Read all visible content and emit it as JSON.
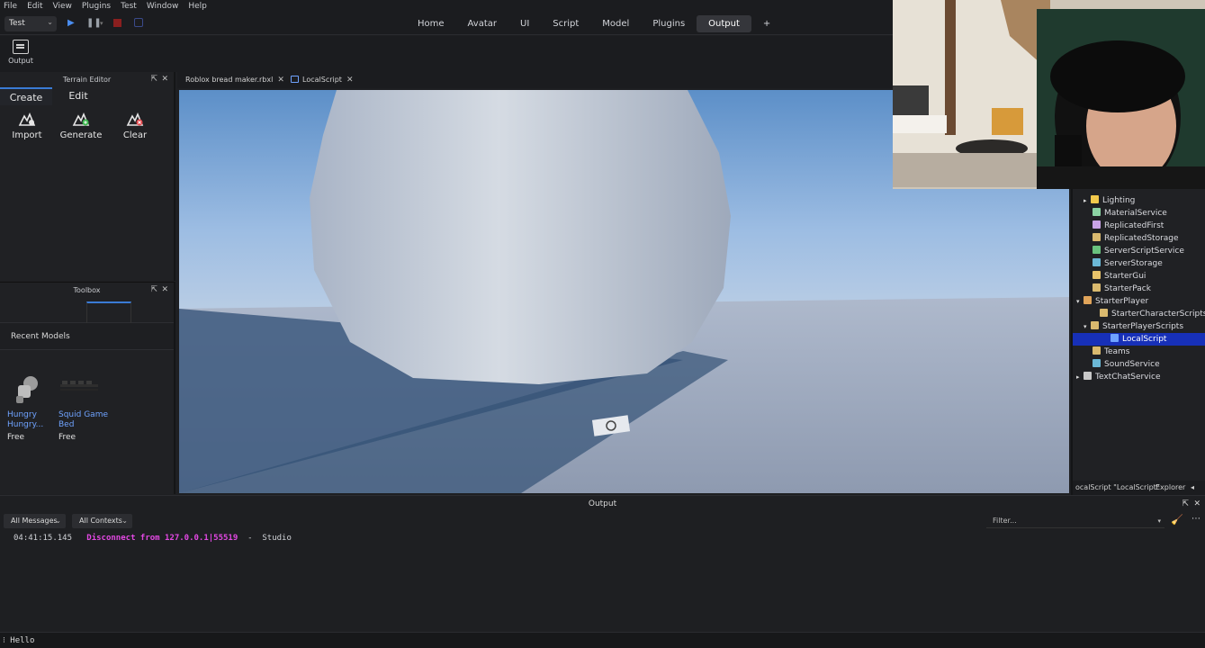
{
  "menubar": [
    "File",
    "Edit",
    "View",
    "Plugins",
    "Test",
    "Window",
    "Help"
  ],
  "toolbar": {
    "mode": "Test"
  },
  "ribbon_tabs": [
    "Home",
    "Avatar",
    "UI",
    "Script",
    "Model",
    "Plugins",
    "Output",
    "+"
  ],
  "ribbon_active": "Output",
  "ribbon": {
    "output_label": "Output"
  },
  "terrain_editor": {
    "title": "Terrain Editor",
    "tabs": [
      "Create",
      "Edit"
    ],
    "tools": [
      "Import",
      "Generate",
      "Clear"
    ]
  },
  "toolbox": {
    "title": "Toolbox",
    "section": "Recent Models",
    "models": [
      {
        "name": "Hungry Hungry...",
        "price": "Free"
      },
      {
        "name": "Squid Game Bed",
        "price": "Free"
      }
    ]
  },
  "doc_tabs": [
    "Roblox bread maker.rbxl",
    "LocalScript"
  ],
  "explorer": {
    "items": [
      {
        "label": "Lighting",
        "icon_color": "#f2c94c",
        "arrow": "▸"
      },
      {
        "label": "MaterialService",
        "icon_color": "#8bd3a3",
        "arrow": ""
      },
      {
        "label": "ReplicatedFirst",
        "icon_color": "#c9a3e6",
        "arrow": ""
      },
      {
        "label": "ReplicatedStorage",
        "icon_color": "#d9b96e",
        "arrow": ""
      },
      {
        "label": "ServerScriptService",
        "icon_color": "#69c27e",
        "arrow": ""
      },
      {
        "label": "ServerStorage",
        "icon_color": "#6bb8d6",
        "arrow": ""
      },
      {
        "label": "StarterGui",
        "icon_color": "#e8c36a",
        "arrow": ""
      },
      {
        "label": "StarterPack",
        "icon_color": "#d9b96e",
        "arrow": ""
      },
      {
        "label": "StarterPlayer",
        "icon_color": "#e0a45a",
        "arrow": "▾"
      },
      {
        "label": "StarterCharacterScripts",
        "icon_color": "#d9b96e",
        "arrow": ""
      },
      {
        "label": "StarterPlayerScripts",
        "icon_color": "#d9b96e",
        "arrow": "▾"
      },
      {
        "label": "LocalScript",
        "icon_color": "#6fa3ff",
        "arrow": ""
      },
      {
        "label": "Teams",
        "icon_color": "#d9b96e",
        "arrow": ""
      },
      {
        "label": "SoundService",
        "icon_color": "#6bb8d6",
        "arrow": ""
      },
      {
        "label": "TextChatService",
        "icon_color": "#c8c8c8",
        "arrow": "▸"
      }
    ],
    "selected": "LocalScript",
    "footer_path": "ocalScript \"LocalScript\"",
    "footer_tab": "Explorer"
  },
  "output": {
    "title": "Output",
    "filter_messages": "All Messages",
    "filter_contexts": "All Contexts",
    "filter_placeholder": "Filter...",
    "log": {
      "time": "04:41:15.145",
      "message": "Disconnect from 127.0.0.1|55519",
      "sep": "  -  ",
      "source": "Studio"
    },
    "command": "Hello"
  },
  "colors": {
    "accent": "#3a7bd5",
    "selection": "#1730b8",
    "log_message": "#e348e3",
    "link": "#6fa3ff"
  }
}
